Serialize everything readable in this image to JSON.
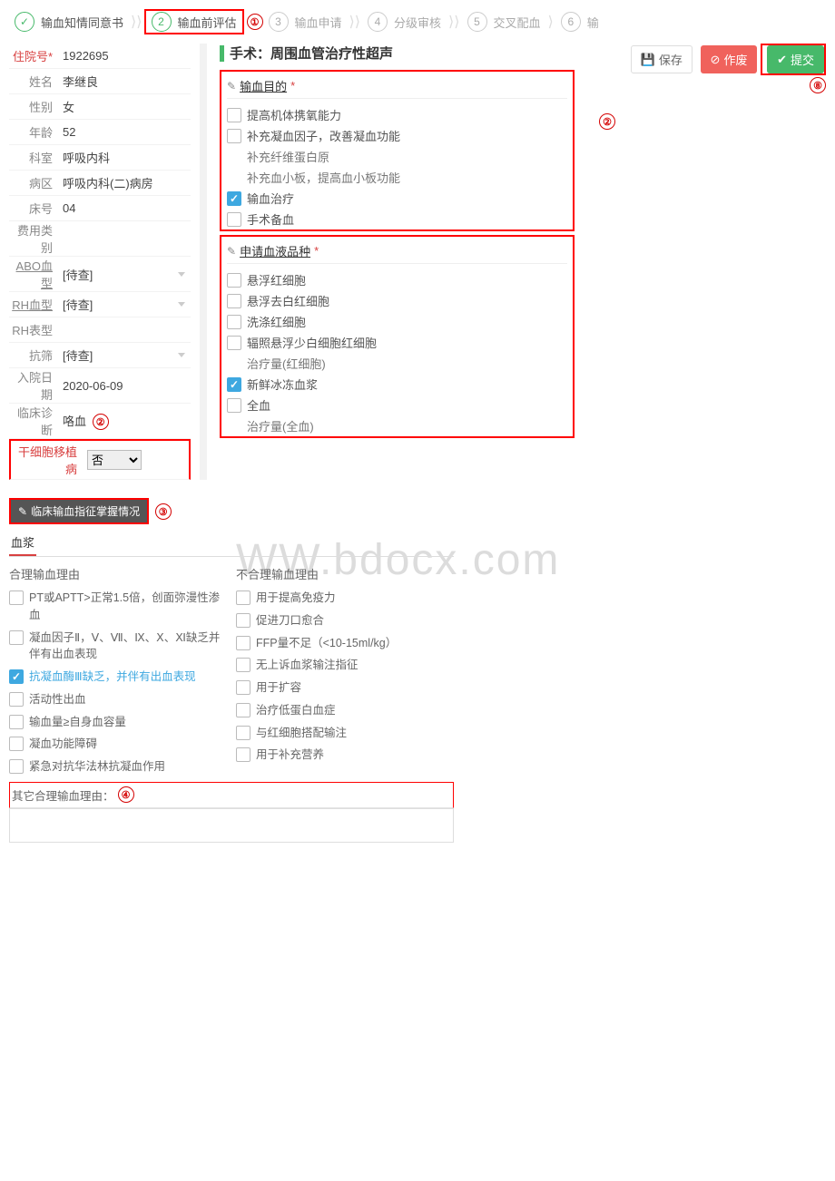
{
  "steps": [
    {
      "num": "✓",
      "label": "输血知情同意书",
      "state": "done"
    },
    {
      "num": "2",
      "label": "输血前评估",
      "state": "active"
    },
    {
      "num": "3",
      "label": "输血申请",
      "state": ""
    },
    {
      "num": "4",
      "label": "分级审核",
      "state": ""
    },
    {
      "num": "5",
      "label": "交叉配血",
      "state": ""
    },
    {
      "num": "6",
      "label": "输",
      "state": ""
    }
  ],
  "annotations": {
    "a1": "①",
    "a2": "②",
    "a2b": "②",
    "a3": "③",
    "a4": "④",
    "a8": "⑧"
  },
  "patient": {
    "id_label": "住院号*",
    "id": "1922695",
    "name_label": "姓名",
    "name": "李继良",
    "sex_label": "性别",
    "sex": "女",
    "age_label": "年龄",
    "age": "52",
    "dept_label": "科室",
    "dept": "呼吸内科",
    "ward_label": "病区",
    "ward": "呼吸内科(二)病房",
    "bed_label": "床号",
    "bed": "04",
    "fee_label": "费用类别",
    "fee": "",
    "abo_label": "ABO血型",
    "abo_ph": "[待查]",
    "rh_label": "RH血型",
    "rh_ph": "[待查]",
    "rhp_label": "RH表型",
    "rhp": "",
    "anti_label": "抗筛",
    "anti_ph": "[待查]",
    "adm_label": "入院日期",
    "adm": "2020-06-09",
    "dx_label": "临床诊断",
    "dx": "咯血",
    "stem_label": "干细胞移植病",
    "stem_sel": "否"
  },
  "form": {
    "title": "手术：周围血管治疗性超声",
    "btn_save": "保存",
    "btn_void": "作废",
    "btn_submit": "提交",
    "sec_purpose": "输血目的",
    "purpose": [
      {
        "t": "提高机体携氧能力",
        "c": false
      },
      {
        "t": "补充凝血因子，改善凝血功能",
        "c": false
      },
      {
        "t": "补充纤维蛋白原",
        "c": false,
        "inset": true
      },
      {
        "t": "补充血小板，提高血小板功能",
        "c": false,
        "inset": true
      },
      {
        "t": "输血治疗",
        "c": true
      },
      {
        "t": "手术备血",
        "c": false
      }
    ],
    "sec_product": "申请血液品种",
    "products": [
      {
        "t": "悬浮红细胞"
      },
      {
        "t": "悬浮去白红细胞"
      },
      {
        "t": "洗涤红细胞"
      },
      {
        "t": "辐照悬浮少白细胞红细胞"
      },
      {
        "t": "治疗量(红细胞)",
        "inset": true
      },
      {
        "t": "新鲜冰冻血浆",
        "c": true
      },
      {
        "t": "全血"
      },
      {
        "t": "治疗量(全血)",
        "inset": true
      }
    ]
  },
  "indication": {
    "head": "临床输血指征掌握情况",
    "tab": "血浆",
    "col1": "合理输血理由",
    "col2": "不合理输血理由",
    "reasons_ok": [
      {
        "t": "PT或APTT>正常1.5倍，创面弥漫性渗血"
      },
      {
        "t": "凝血因子Ⅱ，Ⅴ、Ⅶ、Ⅸ、Ⅹ、Ⅺ缺乏并伴有出血表现"
      },
      {
        "t": "抗凝血酶Ⅲ缺乏，并伴有出血表现",
        "c": true
      },
      {
        "t": "活动性出血"
      },
      {
        "t": "输血量≥自身血容量"
      },
      {
        "t": "凝血功能障碍"
      },
      {
        "t": "紧急对抗华法林抗凝血作用"
      }
    ],
    "reasons_bad": [
      {
        "t": "用于提高免疫力"
      },
      {
        "t": "促进刀口愈合"
      },
      {
        "t": "FFP量不足（<10-15ml/kg）"
      },
      {
        "t": "无上诉血浆输注指征"
      },
      {
        "t": "用于扩容"
      },
      {
        "t": "治疗低蛋白血症"
      },
      {
        "t": "与红细胞搭配输注"
      },
      {
        "t": "用于补充营养"
      }
    ],
    "other_label": "其它合理输血理由："
  },
  "watermark": "WW.bdocx.com"
}
